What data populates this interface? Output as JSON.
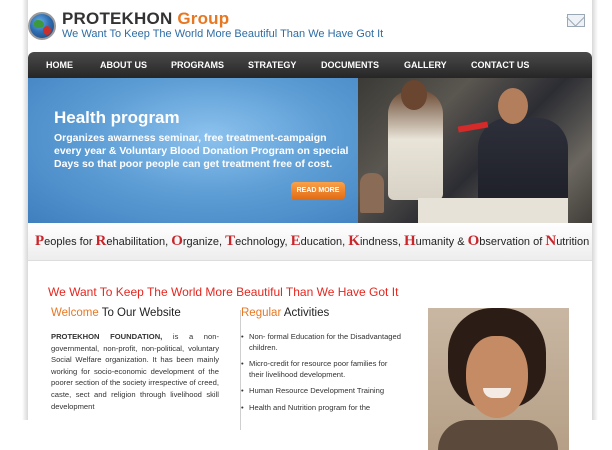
{
  "header": {
    "brand_main": "PROTEKHON",
    "brand_accent": "Group",
    "tagline": "We Want To Keep The World More Beautiful Than We Have Got It",
    "mail_icon": "mail-icon"
  },
  "nav": {
    "items": [
      "HOME",
      "ABOUT US",
      "PROGRAMS",
      "STRATEGY",
      "DOCUMENTS",
      "GALLERY",
      "CONTACT US"
    ]
  },
  "banner": {
    "title": "Health program",
    "text": "Organizes awarness seminar, free treatment-campaign every year & Voluntary Blood Donation Program on special Days so that poor people can get treatment free of cost.",
    "button": "READ MORE"
  },
  "acronym": {
    "parts": [
      {
        "cap": "P",
        "rest": "eoples for "
      },
      {
        "cap": "R",
        "rest": "ehabilitation, "
      },
      {
        "cap": "O",
        "rest": "rganize, "
      },
      {
        "cap": "T",
        "rest": "echnology, "
      },
      {
        "cap": "E",
        "rest": "ducation, "
      },
      {
        "cap": "K",
        "rest": "indness, "
      },
      {
        "cap": "H",
        "rest": "umanity & "
      },
      {
        "cap": "O",
        "rest": "bservation of "
      },
      {
        "cap": "N",
        "rest": "utrition"
      }
    ]
  },
  "content": {
    "heading": "We Want To Keep The World More Beautiful Than We Have Got It",
    "welcome": {
      "accent": "Welcome",
      "rest": " To Our Website",
      "bold": "PROTEKHON FOUNDATION,",
      "text": " is a non-governmental, non-profit, non-political, voluntary Social Welfare organization. It has been mainly working for socio-economic development of the poorer section of the society irrespective of creed, caste, sect and religion through livelihood skill development"
    },
    "activities": {
      "accent": "Regular",
      "rest": " Activities",
      "items": [
        "Non- formal Education for the Disadvantaged children.",
        "Micro-credit for resource poor families for their livelihood development.",
        "Human Resource Development Training",
        "Health and Nutrition program for the"
      ]
    }
  },
  "colors": {
    "accent_orange": "#e87722",
    "accent_red": "#e4271f",
    "nav_bg": "#2f2f2f",
    "banner_blue": "#5f9fd6",
    "acronym_red": "#c8262a"
  }
}
